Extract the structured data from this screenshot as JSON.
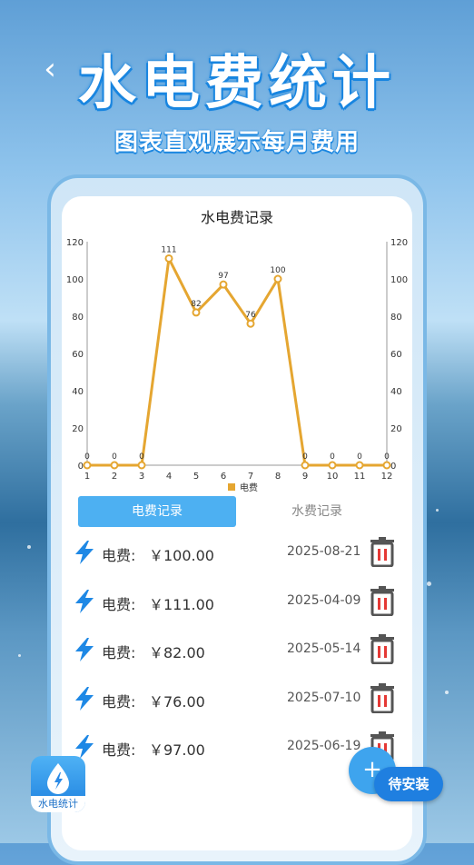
{
  "header": {
    "title": "水电费统计",
    "subtitle": "图表直观展示每月费用"
  },
  "chart_data": {
    "type": "line",
    "title": "水电费记录",
    "x": [
      "1",
      "2",
      "3",
      "4",
      "5",
      "6",
      "7",
      "8",
      "9",
      "10",
      "11",
      "12"
    ],
    "series": [
      {
        "name": "电费",
        "values": [
          0,
          0,
          0,
          111,
          82,
          97,
          76,
          100,
          0,
          0,
          0,
          0
        ]
      }
    ],
    "ylim": [
      0,
      120
    ],
    "yticks": [
      "0",
      "20",
      "40",
      "60",
      "80",
      "100",
      "120"
    ],
    "dual_y_axis": true,
    "legend": "bottom-center",
    "grid": false,
    "color": "#e5a631"
  },
  "tabs": [
    {
      "label": "电费记录",
      "active": true
    },
    {
      "label": "水费记录",
      "active": false
    }
  ],
  "records": [
    {
      "label": "电费:",
      "amount": "￥100.00",
      "date": "2025-08-21"
    },
    {
      "label": "电费:",
      "amount": "￥111.00",
      "date": "2025-04-09"
    },
    {
      "label": "电费:",
      "amount": "￥82.00",
      "date": "2025-05-14"
    },
    {
      "label": "电费:",
      "amount": "￥76.00",
      "date": "2025-07-10"
    },
    {
      "label": "电费:",
      "amount": "￥97.00",
      "date": "2025-06-19"
    }
  ],
  "fab": {
    "label": "+"
  },
  "install": {
    "label": "待安装"
  },
  "appicon": {
    "name": "水电统计"
  },
  "colors": {
    "accent": "#4db0f2",
    "line": "#e5a631",
    "bolt": "#1e88e5",
    "delete": "#e53935"
  }
}
